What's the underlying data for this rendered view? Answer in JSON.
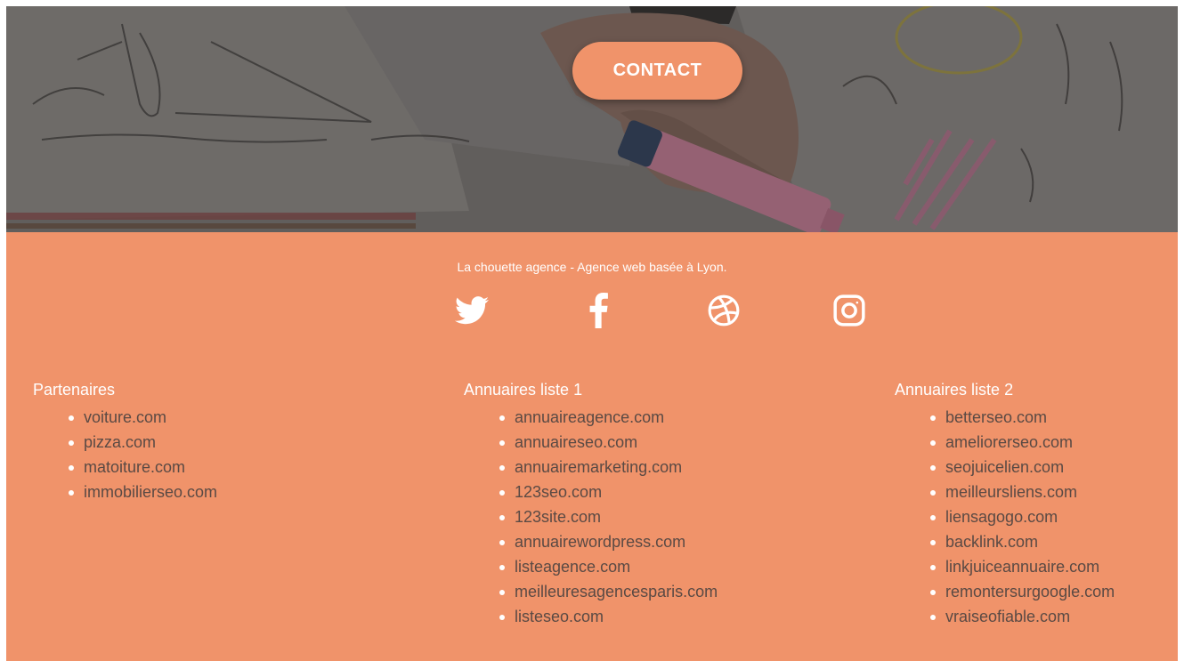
{
  "hero": {
    "contact_label": "CONTACT"
  },
  "footer": {
    "tagline": "La chouette agence - Agence web basée à Lyon.",
    "social": [
      {
        "icon": "twitter-icon"
      },
      {
        "icon": "facebook-icon"
      },
      {
        "icon": "dribbble-icon"
      },
      {
        "icon": "instagram-icon"
      }
    ],
    "columns": [
      {
        "title": "Partenaires",
        "items": [
          "voiture.com",
          "pizza.com",
          "matoiture.com",
          "immobilierseo.com"
        ]
      },
      {
        "title": "Annuaires liste 1",
        "items": [
          "annuaireagence.com",
          "annuaireseo.com",
          "annuairemarketing.com",
          "123seo.com",
          "123site.com",
          "annuairewordpress.com",
          "listeagence.com",
          "meilleuresagencesparis.com",
          "listeseo.com"
        ]
      },
      {
        "title": "Annuaires liste 2",
        "items": [
          "betterseo.com",
          "ameliorerseo.com",
          "seojuicelien.com",
          "meilleursliens.com",
          "liensagogo.com",
          "backlink.com",
          "linkjuiceannuaire.com",
          "remontersurgoogle.com",
          "vraiseofiable.com"
        ]
      }
    ]
  },
  "colors": {
    "accent": "#f0936a",
    "link_text": "#5a4a44",
    "white": "#ffffff"
  }
}
